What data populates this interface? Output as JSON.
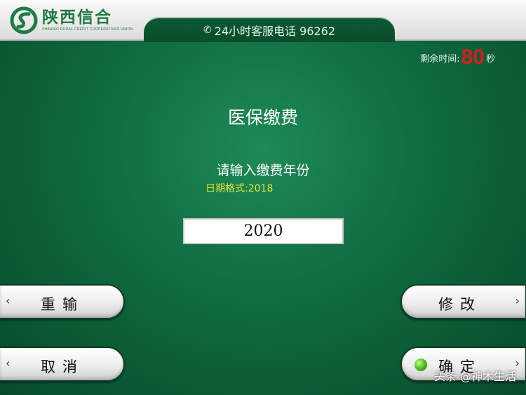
{
  "header": {
    "logo_cn": "陕西信合",
    "logo_en": "SHAANXI RURAL CREDIT COOPERATIVES UNION",
    "hotline": "24小时客服电话 96262"
  },
  "countdown": {
    "label": "剩余时间:",
    "value": "80",
    "unit": "秒"
  },
  "main": {
    "title": "医保缴费",
    "prompt": "请输入缴费年份",
    "hint": "日期格式:2018",
    "input_value": "2020"
  },
  "buttons": {
    "reenter": "重输",
    "cancel": "取消",
    "modify": "修改",
    "confirm": "确定"
  },
  "icons": {
    "left_arrow": "‹",
    "right_arrow": "›",
    "phone": "✆"
  },
  "colors": {
    "background": "#0f6a3f",
    "countdown": "#d81e1e",
    "hint": "#e6e33a",
    "logo": "#1f7a43"
  },
  "watermark": "头条 @神木生活"
}
